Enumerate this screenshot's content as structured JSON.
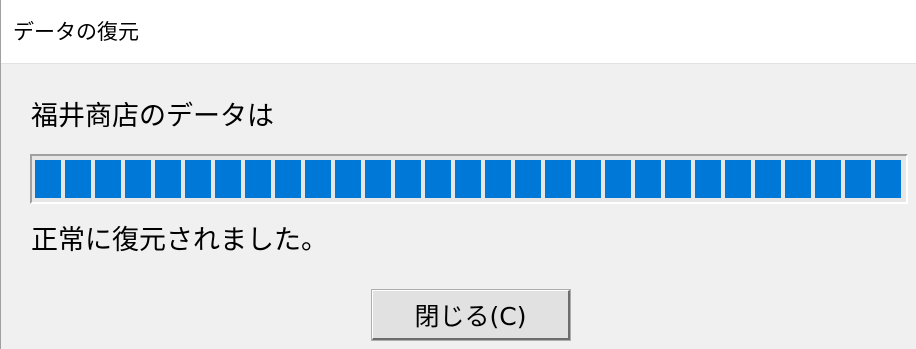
{
  "window": {
    "title": "データの復元"
  },
  "content": {
    "message": "福井商店のデータは",
    "result": "正常に復元されました。"
  },
  "progress": {
    "value_percent": 100,
    "accent_color": "#0078d7",
    "style": "segmented"
  },
  "buttons": {
    "close_label": "閉じる(C)"
  }
}
